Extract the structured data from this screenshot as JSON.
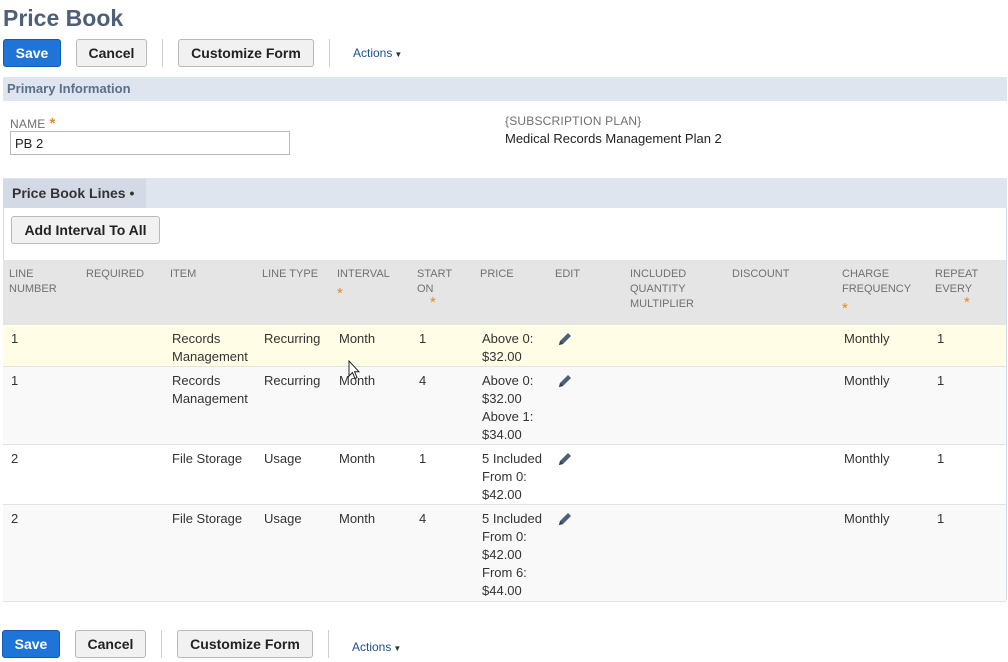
{
  "page": {
    "title": "Price Book"
  },
  "toolbar": {
    "save": "Save",
    "cancel": "Cancel",
    "customize": "Customize Form",
    "actions": "Actions"
  },
  "primary": {
    "section_title": "Primary Information",
    "name_label": "NAME",
    "name_value": "PB 2",
    "subscription_label": "{SUBSCRIPTION PLAN}",
    "subscription_value": "Medical Records Management Plan 2"
  },
  "lines_tab": {
    "label": "Price Book Lines",
    "add_interval": "Add Interval To All",
    "columns": [
      "LINE NUMBER",
      "REQUIRED",
      "ITEM",
      "LINE TYPE",
      "INTERVAL",
      "START ON",
      "PRICE",
      "EDIT",
      "INCLUDED QUANTITY MULTIPLIER",
      "DISCOUNT",
      "CHARGE FREQUENCY",
      "REPEAT EVERY"
    ],
    "rows": [
      {
        "line": "1",
        "required": "",
        "item": "Records Management",
        "type": "Recurring",
        "interval": "Month",
        "start": "1",
        "price": "Above 0: $32.00",
        "multiplier": "",
        "discount": "",
        "frequency": "Monthly",
        "repeat": "1"
      },
      {
        "line": "1",
        "required": "",
        "item": "Records Management",
        "type": "Recurring",
        "interval": "Month",
        "start": "4",
        "price": "Above 0: $32.00 Above 1: $34.00",
        "multiplier": "",
        "discount": "",
        "frequency": "Monthly",
        "repeat": "1"
      },
      {
        "line": "2",
        "required": "",
        "item": "File Storage",
        "type": "Usage",
        "interval": "Month",
        "start": "1",
        "price": "5 Included From 0: $42.00",
        "multiplier": "",
        "discount": "",
        "frequency": "Monthly",
        "repeat": "1"
      },
      {
        "line": "2",
        "required": "",
        "item": "File Storage",
        "type": "Usage",
        "interval": "Month",
        "start": "4",
        "price": "5 Included From 0: $42.00 From 6: $44.00",
        "multiplier": "",
        "discount": "",
        "frequency": "Monthly",
        "repeat": "1"
      }
    ]
  },
  "icons": {
    "edit": "pencil-icon",
    "dropdown": "caret-down-icon",
    "cursor": "mouse-pointer-icon"
  },
  "colors": {
    "primary_button": "#1f74d8",
    "title": "#4d5f79",
    "section_bar": "#dfe5ee",
    "required_star": "#e38b1f",
    "highlight_row": "#fffde6"
  }
}
